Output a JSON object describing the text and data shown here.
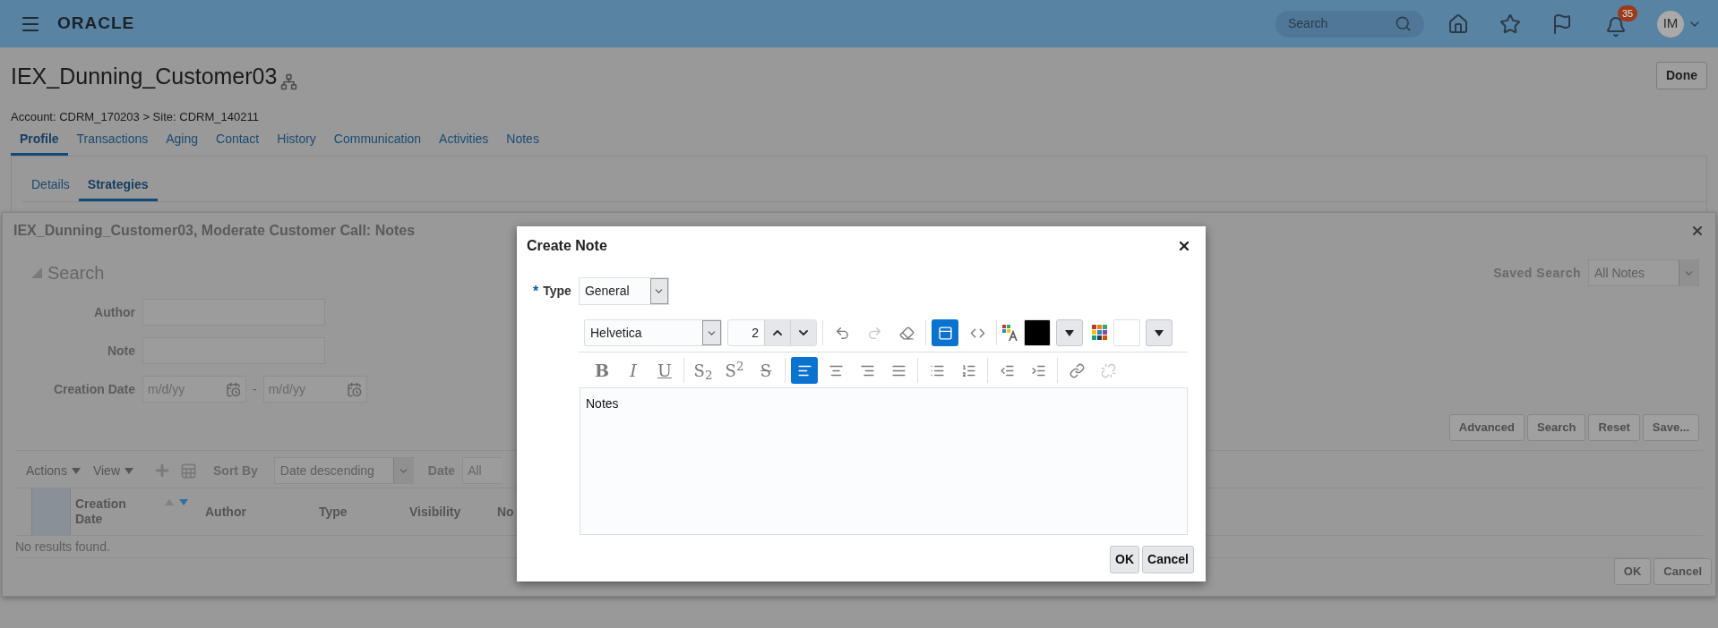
{
  "header": {
    "logo": "ORACLE",
    "search": {
      "placeholder": "Search"
    },
    "notifications_badge": "35",
    "avatar": "IM"
  },
  "page": {
    "title": "IEX_Dunning_Customer03",
    "done_button": "Done",
    "breadcrumb": "Account: CDRM_170203 > Site: CDRM_140211",
    "tabs": [
      {
        "label": "Profile",
        "selected": true
      },
      {
        "label": "Transactions",
        "selected": false
      },
      {
        "label": "Aging",
        "selected": false
      },
      {
        "label": "Contact",
        "selected": false
      },
      {
        "label": "History",
        "selected": false
      },
      {
        "label": "Communication",
        "selected": false
      },
      {
        "label": "Activities",
        "selected": false
      },
      {
        "label": "Notes",
        "selected": false
      }
    ],
    "subtabs": [
      {
        "label": "Details",
        "selected": false
      },
      {
        "label": "Strategies",
        "selected": true
      }
    ]
  },
  "notes_dialog": {
    "title": "IEX_Dunning_Customer03, Moderate Customer Call: Notes",
    "search": {
      "heading": "Search",
      "expanded": true,
      "saved_search_label": "Saved Search",
      "saved_search_value": "All Notes",
      "fields": [
        {
          "label": "Author",
          "kind": "text"
        },
        {
          "label": "Note",
          "kind": "text"
        },
        {
          "label": "Creation Date",
          "kind": "date_range",
          "placeholder_from": "m/d/yy",
          "separator": "-",
          "placeholder_to": "m/d/yy"
        }
      ],
      "buttons": [
        "Advanced",
        "Search",
        "Reset",
        "Save..."
      ]
    },
    "toolbar": {
      "actions": "Actions",
      "view": "View",
      "sort_by_label": "Sort By",
      "sort_by_value": "Date descending",
      "date_label": "Date",
      "date_value": "All"
    },
    "table": {
      "columns": [
        {
          "label": "Creation Date",
          "sortable": true,
          "sorted_descending": true
        },
        {
          "label": "Author",
          "sortable": false,
          "sorted_descending": false
        },
        {
          "label": "Type",
          "sortable": false,
          "sorted_descending": false
        },
        {
          "label": "Visibility",
          "sortable": false,
          "sorted_descending": false
        },
        {
          "label": "No",
          "sortable": false,
          "sorted_descending": false
        }
      ],
      "empty_text": "No results found."
    },
    "buttons": [
      "OK",
      "Cancel"
    ]
  },
  "create_note": {
    "title": "Create Note",
    "type": {
      "required_mark": "*",
      "label": "Type",
      "value": "General"
    },
    "font": "Helvetica",
    "font_size": "2",
    "history_tools": [
      {
        "disabled": false
      },
      {
        "disabled": true
      },
      {
        "disabled": false
      }
    ],
    "mode_tools": [
      {
        "selected": true
      },
      {
        "selected": false
      }
    ],
    "color_pickers": [
      {
        "color": "#000000"
      },
      {
        "color": "#ffffff"
      }
    ],
    "format_tools": [
      {
        "label": "B",
        "selected": false,
        "disabled": false
      },
      {
        "label": "I",
        "selected": false,
        "disabled": false
      },
      {
        "label": "U",
        "selected": false,
        "disabled": false
      },
      {
        "label": "S$_{2}$",
        "selected": false,
        "disabled": false
      },
      {
        "label": "S$^{2}$",
        "selected": false,
        "disabled": false
      },
      {
        "label": "S",
        "selected": false,
        "disabled": false
      }
    ],
    "align_tools": [
      {
        "selected": true
      },
      {
        "selected": false
      },
      {
        "selected": false
      },
      {
        "selected": false
      }
    ],
    "list_tools": [
      {
        "disabled": false
      },
      {
        "disabled": false
      },
      {
        "disabled": false
      },
      {
        "disabled": false
      },
      {
        "disabled": false
      },
      {
        "disabled": true
      }
    ],
    "text": "Notes",
    "buttons": [
      "OK",
      "Cancel"
    ]
  }
}
